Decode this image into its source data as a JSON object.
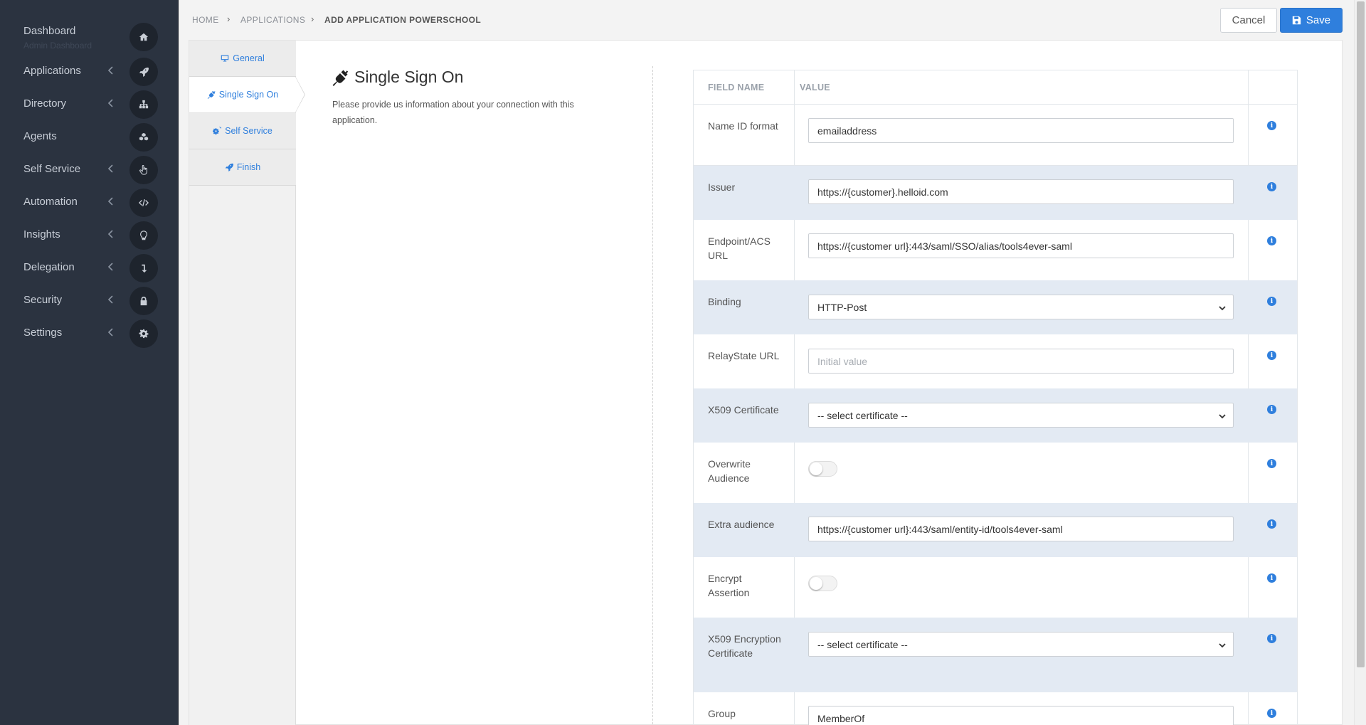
{
  "sidebar": {
    "items": [
      {
        "label": "Dashboard",
        "sub": "Admin Dashboard",
        "icon": "home-icon",
        "chevron": false
      },
      {
        "label": "Applications",
        "icon": "rocket-icon",
        "chevron": true
      },
      {
        "label": "Directory",
        "icon": "sitemap-icon",
        "chevron": true
      },
      {
        "label": "Agents",
        "icon": "cubes-icon",
        "chevron": false
      },
      {
        "label": "Self Service",
        "icon": "hand-pointer-icon",
        "chevron": true
      },
      {
        "label": "Automation",
        "icon": "code-icon",
        "chevron": true
      },
      {
        "label": "Insights",
        "icon": "lightbulb-icon",
        "chevron": true
      },
      {
        "label": "Delegation",
        "icon": "level-down-icon",
        "chevron": true
      },
      {
        "label": "Security",
        "icon": "lock-icon",
        "chevron": true
      },
      {
        "label": "Settings",
        "icon": "gear-icon",
        "chevron": true
      }
    ]
  },
  "breadcrumb": {
    "home": "HOME",
    "applications": "APPLICATIONS",
    "current": "ADD APPLICATION POWERSCHOOL"
  },
  "actions": {
    "cancel": "Cancel",
    "save": "Save"
  },
  "steps": [
    {
      "label": "General",
      "icon": "desktop-icon"
    },
    {
      "label": "Single Sign On",
      "icon": "plug-icon"
    },
    {
      "label": "Self Service",
      "icon": "cogs-icon"
    },
    {
      "label": "Finish",
      "icon": "rocket-icon"
    }
  ],
  "section": {
    "title": "Single Sign On",
    "description": "Please provide us information about your connection with this application."
  },
  "table": {
    "headers": {
      "field_name": "FIELD NAME",
      "value": "VALUE"
    },
    "rows": [
      {
        "name": "Name ID format",
        "type": "input",
        "value": "emailaddress"
      },
      {
        "name": "Issuer",
        "type": "input",
        "value": "https://{customer}.helloid.com"
      },
      {
        "name": "Endpoint/ACS URL",
        "type": "input",
        "value": "https://{customer url}:443/saml/SSO/alias/tools4ever-saml"
      },
      {
        "name": "Binding",
        "type": "select",
        "value": "HTTP-Post"
      },
      {
        "name": "RelayState URL",
        "type": "input",
        "value": "",
        "placeholder": "Initial value"
      },
      {
        "name": "X509 Certificate",
        "type": "select",
        "value": "-- select certificate --"
      },
      {
        "name": "Overwrite Audience",
        "type": "toggle",
        "value": "off"
      },
      {
        "name": "Extra audience",
        "type": "input",
        "value": "https://{customer url}:443/saml/entity-id/tools4ever-saml"
      },
      {
        "name": "Encrypt Assertion",
        "type": "toggle",
        "value": "off"
      },
      {
        "name": "X509 Encryption Certificate",
        "type": "select",
        "value": "-- select certificate --"
      },
      {
        "name": "Group",
        "type": "input",
        "value": "MemberOf"
      }
    ]
  },
  "colors": {
    "accent": "#2f7fdd",
    "sidebar_bg": "#2b3340",
    "row_alt": "#e3eaf3"
  }
}
